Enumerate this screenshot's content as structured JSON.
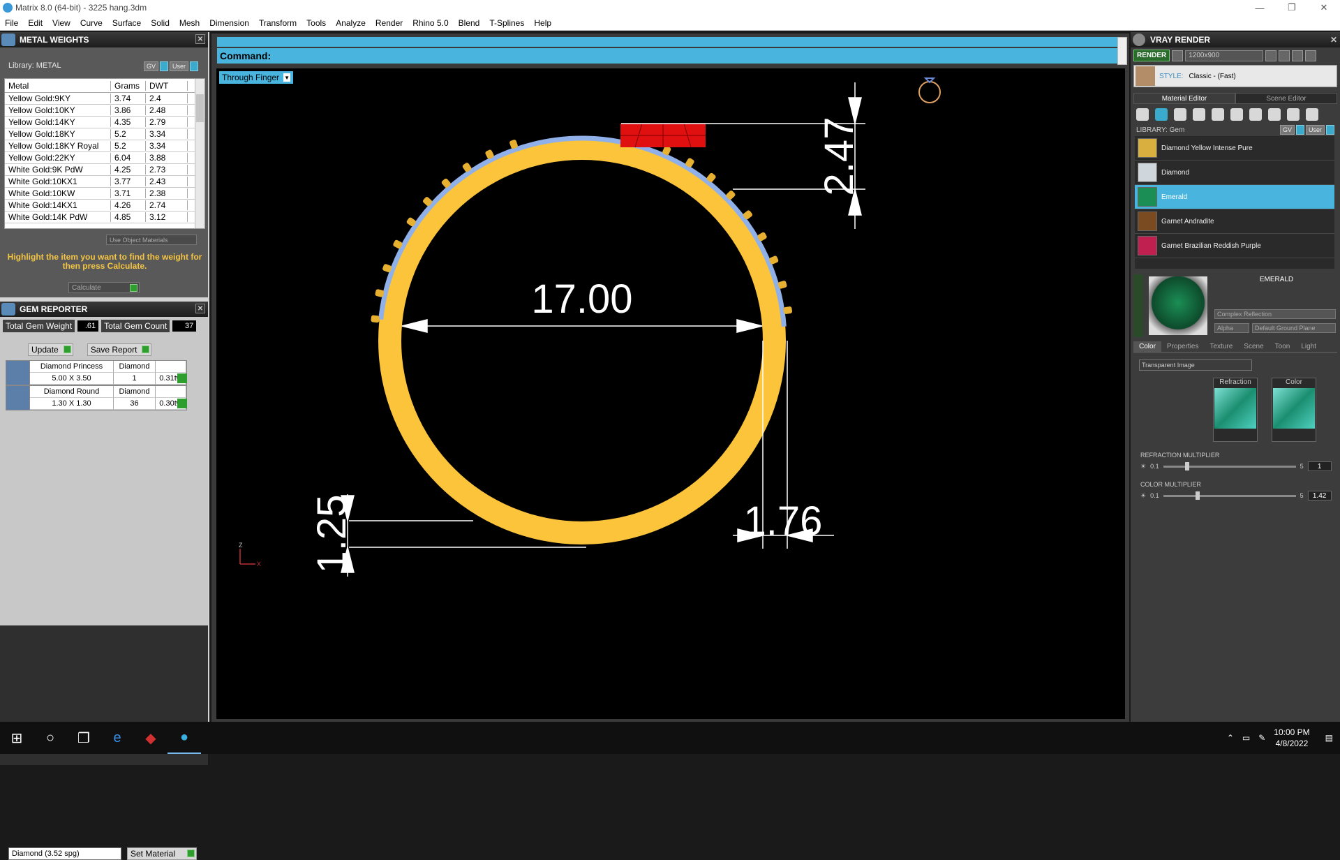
{
  "window": {
    "title": "Matrix 8.0 (64-bit) - 3225 hang.3dm",
    "minimize": "—",
    "maximize": "❐",
    "close": "✕"
  },
  "menu": [
    "File",
    "Edit",
    "View",
    "Curve",
    "Surface",
    "Solid",
    "Mesh",
    "Dimension",
    "Transform",
    "Tools",
    "Analyze",
    "Render",
    "Rhino 5.0",
    "Blend",
    "T-Splines",
    "Help"
  ],
  "metal_weights": {
    "title": "METAL WEIGHTS",
    "library": "Library: METAL",
    "gv": "GV",
    "user": "User",
    "columns": [
      "Metal",
      "Grams",
      "DWT"
    ],
    "rows": [
      [
        "Yellow Gold:9KY",
        "3.74",
        "2.4"
      ],
      [
        "Yellow Gold:10KY",
        "3.86",
        "2.48"
      ],
      [
        "Yellow Gold:14KY",
        "4.35",
        "2.79"
      ],
      [
        "Yellow Gold:18KY",
        "5.2",
        "3.34"
      ],
      [
        "Yellow Gold:18KY Royal",
        "5.2",
        "3.34"
      ],
      [
        "Yellow Gold:22KY",
        "6.04",
        "3.88"
      ],
      [
        "White Gold:9K PdW",
        "4.25",
        "2.73"
      ],
      [
        "White Gold:10KX1",
        "3.77",
        "2.43"
      ],
      [
        "White Gold:10KW",
        "3.71",
        "2.38"
      ],
      [
        "White Gold:14KX1",
        "4.26",
        "2.74"
      ],
      [
        "White Gold:14K PdW",
        "4.85",
        "3.12"
      ]
    ],
    "use_object_materials": "Use Object Materials",
    "hint": "Highlight the item you want to find the weight for then press Calculate.",
    "calculate": "Calculate"
  },
  "gem_reporter": {
    "title": "GEM REPORTER",
    "total_weight_label": "Total Gem Weight",
    "total_weight_value": ".61",
    "total_count_label": "Total Gem Count",
    "total_count_value": "37",
    "update": "Update",
    "save_report": "Save Report",
    "gems": [
      {
        "shape": "Diamond Princess",
        "material": "Diamond",
        "size": "5.00 X 3.50",
        "count": "1",
        "weight": "0.31tw"
      },
      {
        "shape": "Diamond Round",
        "material": "Diamond",
        "size": "1.30 X 1.30",
        "count": "36",
        "weight": "0.30tw"
      }
    ],
    "material_select": "Diamond    (3.52 spg)",
    "set_material": "Set Material"
  },
  "command": {
    "label": "Command:"
  },
  "viewport": {
    "mode": "Through Finger",
    "dims": {
      "inner": "17.00",
      "top": "2.47",
      "bottom_left": "1.25",
      "bottom_right": "1.76"
    },
    "axis_z": "Z",
    "axis_x": "X",
    "colors": {
      "metal": "#fbc43b",
      "pave": "#8fb0e8",
      "center_stone": "#e01010"
    }
  },
  "vray": {
    "title": "VRAY RENDER",
    "render": "RENDER",
    "resolution": "1200x900",
    "style_label": "STYLE:",
    "style_value": "Classic - (Fast)",
    "tabs": [
      "Material Editor",
      "Scene Editor"
    ],
    "library": "LIBRARY: Gem",
    "gv": "GV",
    "user": "User",
    "gems": [
      "Diamond Yellow Intense Pure",
      "Diamond",
      "Emerald",
      "Garnet Andradite",
      "Garnet Brazilian Reddish Purple"
    ],
    "selected_gem": "Emerald",
    "material_name": "EMERALD",
    "reflection": "Complex Reflection",
    "alpha": "Alpha",
    "ground": "Default Ground Plane",
    "prop_tabs": [
      "Color",
      "Properties",
      "Texture",
      "Scene",
      "Toon",
      "Light"
    ],
    "image_mode": "Transparent Image",
    "slots": [
      "Refraction",
      "Color"
    ],
    "refraction_multiplier": {
      "label": "REFRACTION MULTIPLIER",
      "min": "0.1",
      "max": "5",
      "value": "1"
    },
    "color_multiplier": {
      "label": "COLOR MULTIPLIER",
      "min": "0.1",
      "max": "5",
      "value": "1.42"
    }
  },
  "taskbar": {
    "time": "10:00 PM",
    "date": "4/8/2022"
  }
}
